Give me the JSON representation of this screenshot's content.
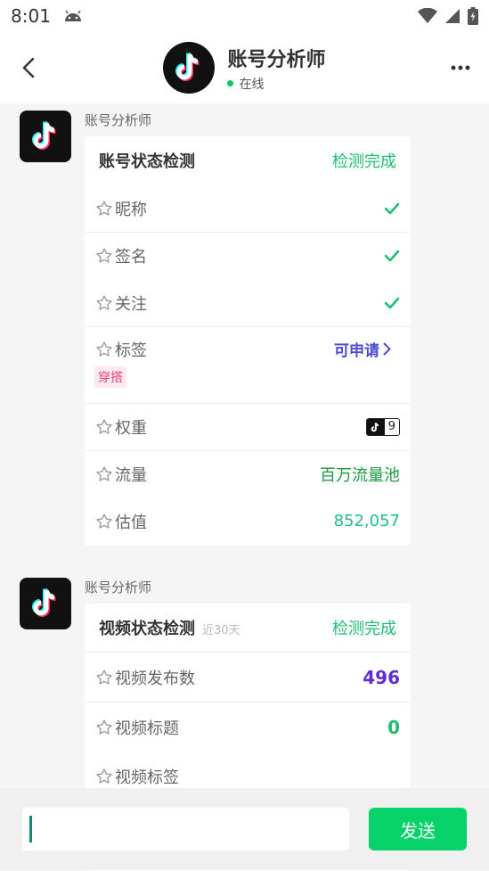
{
  "status": {
    "time": "8:01"
  },
  "header": {
    "title": "账号分析师",
    "online": "在线"
  },
  "messages": [
    {
      "sender": "账号分析师",
      "card": {
        "title": "账号状态检测",
        "status": "检测完成",
        "rows": {
          "nickname": "昵称",
          "signature": "签名",
          "follow": "关注",
          "tags": "标签",
          "apply": "可申请",
          "tag_chip": "穿搭",
          "weight": "权重",
          "weight_value": "9",
          "traffic": "流量",
          "traffic_value": "百万流量池",
          "valuation": "估值",
          "valuation_value": "852,057"
        }
      }
    },
    {
      "sender": "账号分析师",
      "card": {
        "title": "视频状态检测",
        "subtitle": "近30天",
        "status": "检测完成",
        "rows": {
          "video_count": "视频发布数",
          "video_count_value": "496",
          "video_title": "视频标题",
          "video_title_value": "0",
          "video_tags": "视频标签"
        }
      }
    }
  ],
  "composer": {
    "send_label": "发送"
  },
  "colors": {
    "accent": "#08d36a",
    "done": "#1dbf73",
    "purple": "#5f2cd6"
  }
}
